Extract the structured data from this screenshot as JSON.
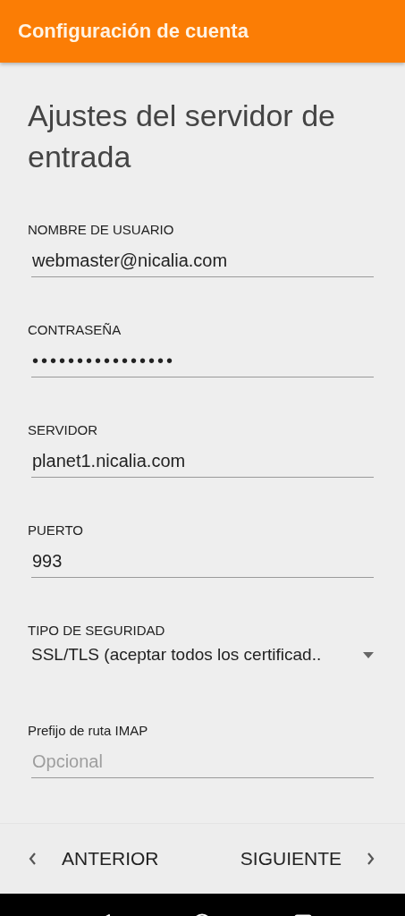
{
  "app_bar": {
    "title": "Configuración de cuenta"
  },
  "heading": "Ajustes del servidor de entrada",
  "fields": [
    {
      "kind": "text",
      "label": "NOMBRE DE USUARIO",
      "value": "webmaster@nicalia.com"
    },
    {
      "kind": "password",
      "label": "CONTRASEÑA",
      "value": "••••••••••••••••"
    },
    {
      "kind": "text",
      "label": "SERVIDOR",
      "value": "planet1.nicalia.com"
    },
    {
      "kind": "text",
      "label": "PUERTO",
      "value": "993"
    },
    {
      "kind": "select",
      "label": "TIPO DE SEGURIDAD",
      "value": "SSL/TLS (aceptar todos los certificad.."
    },
    {
      "kind": "text",
      "label": "Prefijo de ruta IMAP",
      "placeholder": "Opcional"
    }
  ],
  "footer": {
    "previous": "ANTERIOR",
    "next": "SIGUIENTE"
  }
}
